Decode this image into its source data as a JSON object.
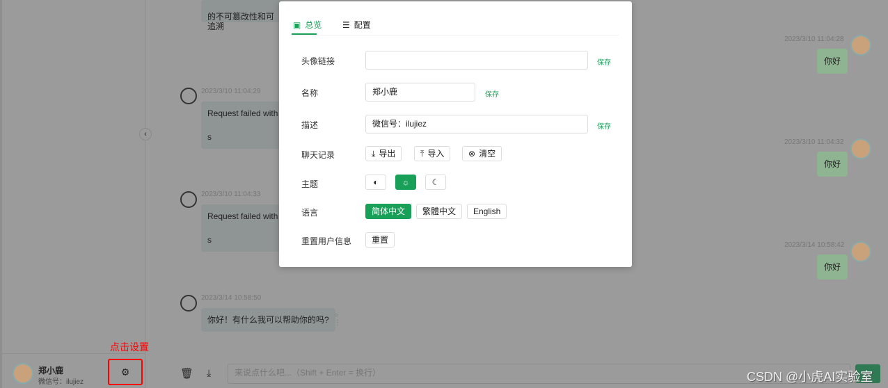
{
  "sidebar": {
    "user_name": "郑小鹿",
    "user_desc": "微信号：ilujiez",
    "annotation": "点击设置"
  },
  "chat": {
    "top_text": "的不可篡改性和可追溯",
    "messages": [
      {
        "role": "user",
        "time": "2023/3/10 11:04:28",
        "text": "你好"
      },
      {
        "role": "bot",
        "time": "2023/3/10 11:04:29",
        "text": "Request failed with s"
      },
      {
        "role": "user",
        "time": "2023/3/10 11:04:32",
        "text": "你好"
      },
      {
        "role": "bot",
        "time": "2023/3/10 11:04:33",
        "text": "Request failed with s"
      },
      {
        "role": "user",
        "time": "2023/3/14 10:58:42",
        "text": "你好"
      },
      {
        "role": "bot",
        "time": "2023/3/14 10:58:50",
        "text": "你好！有什么我可以帮助你的吗?"
      }
    ],
    "input_placeholder": "来说点什么吧...（Shift + Enter = 换行）",
    "watermark": "CSDN @小虎AI实验室"
  },
  "settings": {
    "tabs": [
      "总览",
      "配置"
    ],
    "avatar_label": "头像链接",
    "avatar_value": "",
    "save": "保存",
    "name_label": "名称",
    "name_value": "郑小鹿",
    "desc_label": "描述",
    "desc_value": "微信号：ilujiez",
    "history_label": "聊天记录",
    "export": "导出",
    "import": "导入",
    "clear": "清空",
    "theme_label": "主题",
    "theme_selected": "light",
    "lang_label": "语言",
    "langs": [
      "简体中文",
      "繁體中文",
      "English"
    ],
    "lang_selected": "简体中文",
    "reset_label": "重置用户信息",
    "reset": "重置"
  },
  "colors": {
    "accent": "#18a058",
    "annotation": "#ff0000"
  }
}
